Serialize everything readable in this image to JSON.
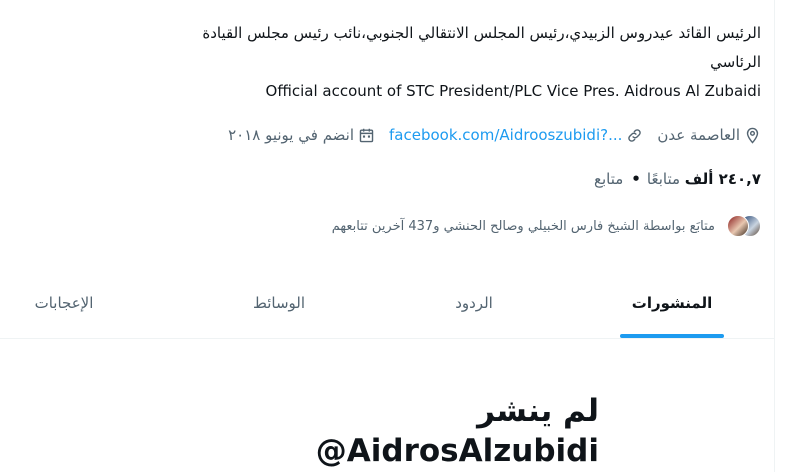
{
  "profile": {
    "bio_line1": "الرئيس القائد عيدروس الزبيدي،رئيس المجلس الانتقالي الجنوبي،نائب رئيس مجلس القيادة",
    "bio_line2": "الرئاسي",
    "bio_english": "Official account of STC President/PLC Vice Pres. Aidrous Al Zubaidi",
    "location": "العاصمة عدن",
    "website": "facebook.com/Aidrooszubidi?...",
    "joined": "انضم في يونيو ٢٠١٨",
    "following_count": "٢٤٠,٧ ألف",
    "following_label": "متابعًا",
    "followers_label": "متابع",
    "followers_known": "متابَع بواسطة الشيخ فارس الخبيلي وصالح الحنشي و437 آخرين تتابعهم"
  },
  "tabs": [
    {
      "label": "المنشورات",
      "active": true
    },
    {
      "label": "الردود",
      "active": false
    },
    {
      "label": "الوسائط",
      "active": false
    },
    {
      "label": "الإعجابات",
      "active": false
    }
  ],
  "empty_state": {
    "title": "لم ينشر",
    "handle": "@AidrosAlzubidi"
  },
  "colors": {
    "accent": "#1d9bf0",
    "text_primary": "#0f1419",
    "text_secondary": "#536471",
    "border": "#eff3f4"
  },
  "icons": [
    "location-icon",
    "link-icon",
    "calendar-icon"
  ]
}
